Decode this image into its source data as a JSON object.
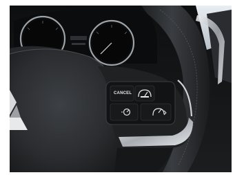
{
  "steering_controls": {
    "cancel_label": "CANCEL",
    "icons": [
      "cruise-speed-icon",
      "cruise-set-icon",
      "cruise-resume-icon"
    ]
  },
  "colors": {
    "background": "#ffffff",
    "dashboard": "#141516",
    "wheel_leather": "#2c2e30",
    "chrome": "#c9ccd0",
    "button_face": "#18191b"
  }
}
